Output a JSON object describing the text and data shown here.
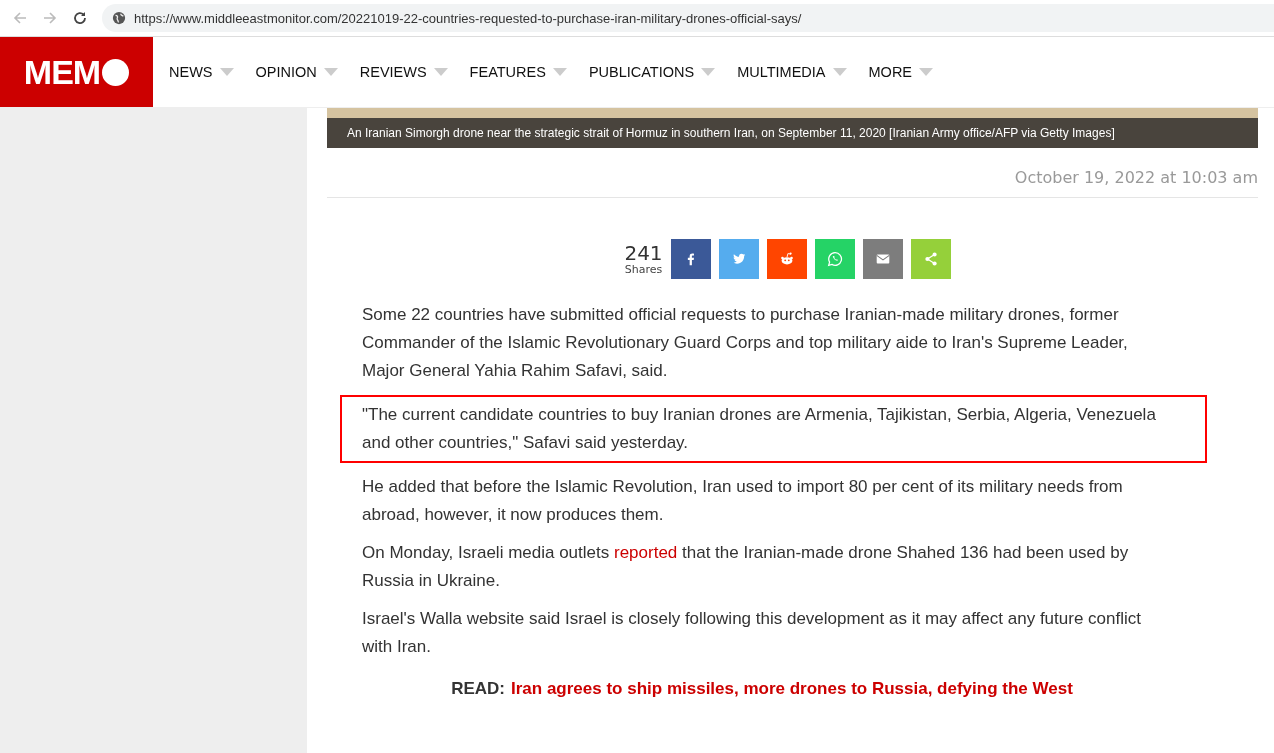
{
  "browser": {
    "url": "https://www.middleeastmonitor.com/20221019-22-countries-requested-to-purchase-iran-military-drones-official-says/"
  },
  "logo": "MEM",
  "nav": [
    {
      "label": "NEWS"
    },
    {
      "label": "OPINION"
    },
    {
      "label": "REVIEWS"
    },
    {
      "label": "FEATURES"
    },
    {
      "label": "PUBLICATIONS"
    },
    {
      "label": "MULTIMEDIA"
    },
    {
      "label": "MORE"
    }
  ],
  "caption": "An Iranian Simorgh drone near the strategic strait of Hormuz in southern Iran, on September 11, 2020 [Iranian Army office/AFP via Getty Images]",
  "date": "October 19, 2022 at 10:03 am",
  "shares": {
    "count": "241",
    "label": "Shares",
    "buttons": [
      {
        "kind": "facebook"
      },
      {
        "kind": "twitter"
      },
      {
        "kind": "reddit"
      },
      {
        "kind": "whatsapp"
      },
      {
        "kind": "email"
      },
      {
        "kind": "share"
      }
    ]
  },
  "paragraphs": [
    {
      "highlighted": false,
      "parts": [
        {
          "text": "Some 22 countries have submitted official requests to purchase Iranian-made military drones, former Commander of the Islamic Revolutionary Guard Corps and top military aide to Iran's Supreme Leader, Major General Yahia Rahim Safavi, said.",
          "link": false
        }
      ]
    },
    {
      "highlighted": true,
      "parts": [
        {
          "text": "\"The current candidate countries to buy Iranian drones are Armenia, Tajikistan, Serbia, Algeria, Venezuela and other countries,\" Safavi said yesterday.",
          "link": false
        }
      ]
    },
    {
      "highlighted": false,
      "parts": [
        {
          "text": "He added that before the Islamic Revolution, Iran used to import 80 per cent of its military needs from abroad, however, it now produces them.",
          "link": false
        }
      ]
    },
    {
      "highlighted": false,
      "parts": [
        {
          "text": "On Monday, Israeli media outlets ",
          "link": false
        },
        {
          "text": "reported",
          "link": true
        },
        {
          "text": " that the Iranian-made drone Shahed 136 had been used by Russia in Ukraine.",
          "link": false
        }
      ]
    },
    {
      "highlighted": false,
      "parts": [
        {
          "text": "Israel's Walla website said Israel is closely following this development as it may affect any future conflict with Iran.",
          "link": false
        }
      ]
    }
  ],
  "read_more": {
    "label": "READ:",
    "link": "Iran agrees to ship missiles, more drones to Russia, defying the West"
  }
}
